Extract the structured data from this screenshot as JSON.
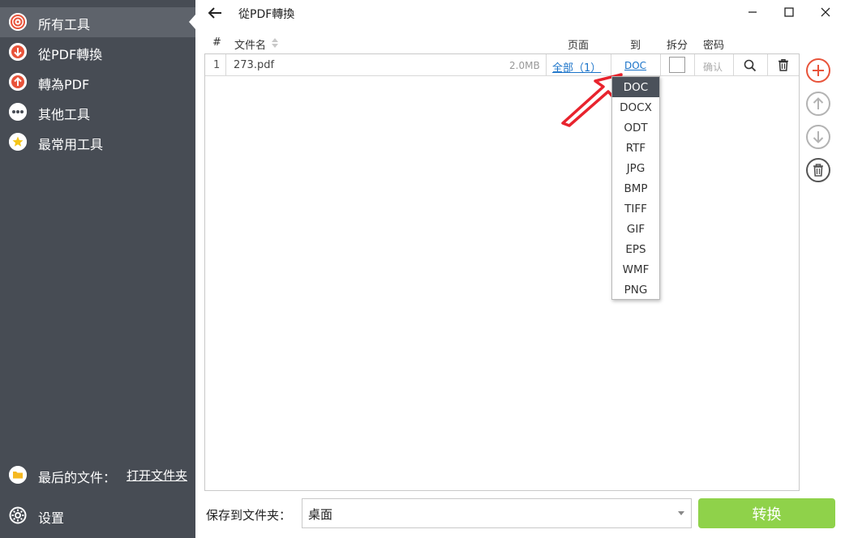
{
  "sidebar": {
    "items": [
      {
        "label": "所有工具",
        "icon": "target-icon"
      },
      {
        "label": "從PDF轉換",
        "icon": "arrow-down-icon"
      },
      {
        "label": "轉為PDF",
        "icon": "arrow-up-icon"
      },
      {
        "label": "其他工具",
        "icon": "more-dots-icon"
      },
      {
        "label": "最常用工具",
        "icon": "star-icon"
      }
    ],
    "recent_label": "最后的文件：",
    "recent_link": "打开文件夹",
    "settings_label": "设置"
  },
  "window": {
    "title": "從PDF轉換"
  },
  "table": {
    "headers": {
      "index": "#",
      "filename": "文件名",
      "pages": "页面",
      "to": "到",
      "split": "拆分",
      "password": "密码"
    },
    "rows": [
      {
        "index": "1",
        "filename": "273.pdf",
        "size": "2.0MB",
        "pages": "全部（1）",
        "format": "DOC",
        "password": "确认"
      }
    ]
  },
  "format_dropdown": {
    "selected": "DOC",
    "options": [
      "DOC",
      "DOCX",
      "ODT",
      "RTF",
      "JPG",
      "BMP",
      "TIFF",
      "GIF",
      "EPS",
      "WMF",
      "PNG"
    ]
  },
  "bottom": {
    "save_label": "保存到文件夹：",
    "folder_value": "桌面",
    "convert_label": "转换"
  },
  "colors": {
    "sidebar_bg": "#474c54",
    "accent_red": "#e8533a",
    "convert_green": "#8fd24a",
    "link_blue": "#1a73c9",
    "annotation_arrow": "#e8232d"
  }
}
